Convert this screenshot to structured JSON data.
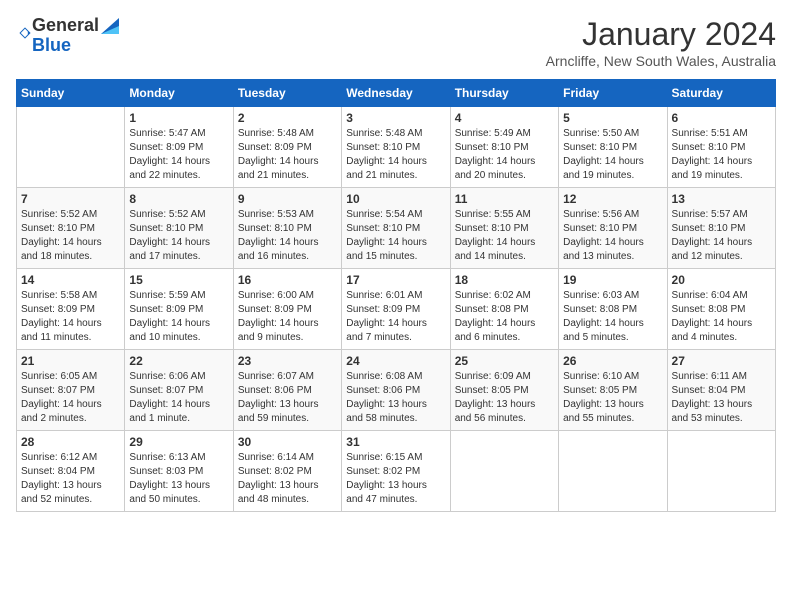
{
  "logo": {
    "general": "General",
    "blue": "Blue"
  },
  "title": "January 2024",
  "subtitle": "Arncliffe, New South Wales, Australia",
  "days_of_week": [
    "Sunday",
    "Monday",
    "Tuesday",
    "Wednesday",
    "Thursday",
    "Friday",
    "Saturday"
  ],
  "weeks": [
    [
      {
        "num": "",
        "info": ""
      },
      {
        "num": "1",
        "info": "Sunrise: 5:47 AM\nSunset: 8:09 PM\nDaylight: 14 hours\nand 22 minutes."
      },
      {
        "num": "2",
        "info": "Sunrise: 5:48 AM\nSunset: 8:09 PM\nDaylight: 14 hours\nand 21 minutes."
      },
      {
        "num": "3",
        "info": "Sunrise: 5:48 AM\nSunset: 8:10 PM\nDaylight: 14 hours\nand 21 minutes."
      },
      {
        "num": "4",
        "info": "Sunrise: 5:49 AM\nSunset: 8:10 PM\nDaylight: 14 hours\nand 20 minutes."
      },
      {
        "num": "5",
        "info": "Sunrise: 5:50 AM\nSunset: 8:10 PM\nDaylight: 14 hours\nand 19 minutes."
      },
      {
        "num": "6",
        "info": "Sunrise: 5:51 AM\nSunset: 8:10 PM\nDaylight: 14 hours\nand 19 minutes."
      }
    ],
    [
      {
        "num": "7",
        "info": "Sunrise: 5:52 AM\nSunset: 8:10 PM\nDaylight: 14 hours\nand 18 minutes."
      },
      {
        "num": "8",
        "info": "Sunrise: 5:52 AM\nSunset: 8:10 PM\nDaylight: 14 hours\nand 17 minutes."
      },
      {
        "num": "9",
        "info": "Sunrise: 5:53 AM\nSunset: 8:10 PM\nDaylight: 14 hours\nand 16 minutes."
      },
      {
        "num": "10",
        "info": "Sunrise: 5:54 AM\nSunset: 8:10 PM\nDaylight: 14 hours\nand 15 minutes."
      },
      {
        "num": "11",
        "info": "Sunrise: 5:55 AM\nSunset: 8:10 PM\nDaylight: 14 hours\nand 14 minutes."
      },
      {
        "num": "12",
        "info": "Sunrise: 5:56 AM\nSunset: 8:10 PM\nDaylight: 14 hours\nand 13 minutes."
      },
      {
        "num": "13",
        "info": "Sunrise: 5:57 AM\nSunset: 8:10 PM\nDaylight: 14 hours\nand 12 minutes."
      }
    ],
    [
      {
        "num": "14",
        "info": "Sunrise: 5:58 AM\nSunset: 8:09 PM\nDaylight: 14 hours\nand 11 minutes."
      },
      {
        "num": "15",
        "info": "Sunrise: 5:59 AM\nSunset: 8:09 PM\nDaylight: 14 hours\nand 10 minutes."
      },
      {
        "num": "16",
        "info": "Sunrise: 6:00 AM\nSunset: 8:09 PM\nDaylight: 14 hours\nand 9 minutes."
      },
      {
        "num": "17",
        "info": "Sunrise: 6:01 AM\nSunset: 8:09 PM\nDaylight: 14 hours\nand 7 minutes."
      },
      {
        "num": "18",
        "info": "Sunrise: 6:02 AM\nSunset: 8:08 PM\nDaylight: 14 hours\nand 6 minutes."
      },
      {
        "num": "19",
        "info": "Sunrise: 6:03 AM\nSunset: 8:08 PM\nDaylight: 14 hours\nand 5 minutes."
      },
      {
        "num": "20",
        "info": "Sunrise: 6:04 AM\nSunset: 8:08 PM\nDaylight: 14 hours\nand 4 minutes."
      }
    ],
    [
      {
        "num": "21",
        "info": "Sunrise: 6:05 AM\nSunset: 8:07 PM\nDaylight: 14 hours\nand 2 minutes."
      },
      {
        "num": "22",
        "info": "Sunrise: 6:06 AM\nSunset: 8:07 PM\nDaylight: 14 hours\nand 1 minute."
      },
      {
        "num": "23",
        "info": "Sunrise: 6:07 AM\nSunset: 8:06 PM\nDaylight: 13 hours\nand 59 minutes."
      },
      {
        "num": "24",
        "info": "Sunrise: 6:08 AM\nSunset: 8:06 PM\nDaylight: 13 hours\nand 58 minutes."
      },
      {
        "num": "25",
        "info": "Sunrise: 6:09 AM\nSunset: 8:05 PM\nDaylight: 13 hours\nand 56 minutes."
      },
      {
        "num": "26",
        "info": "Sunrise: 6:10 AM\nSunset: 8:05 PM\nDaylight: 13 hours\nand 55 minutes."
      },
      {
        "num": "27",
        "info": "Sunrise: 6:11 AM\nSunset: 8:04 PM\nDaylight: 13 hours\nand 53 minutes."
      }
    ],
    [
      {
        "num": "28",
        "info": "Sunrise: 6:12 AM\nSunset: 8:04 PM\nDaylight: 13 hours\nand 52 minutes."
      },
      {
        "num": "29",
        "info": "Sunrise: 6:13 AM\nSunset: 8:03 PM\nDaylight: 13 hours\nand 50 minutes."
      },
      {
        "num": "30",
        "info": "Sunrise: 6:14 AM\nSunset: 8:02 PM\nDaylight: 13 hours\nand 48 minutes."
      },
      {
        "num": "31",
        "info": "Sunrise: 6:15 AM\nSunset: 8:02 PM\nDaylight: 13 hours\nand 47 minutes."
      },
      {
        "num": "",
        "info": ""
      },
      {
        "num": "",
        "info": ""
      },
      {
        "num": "",
        "info": ""
      }
    ]
  ]
}
